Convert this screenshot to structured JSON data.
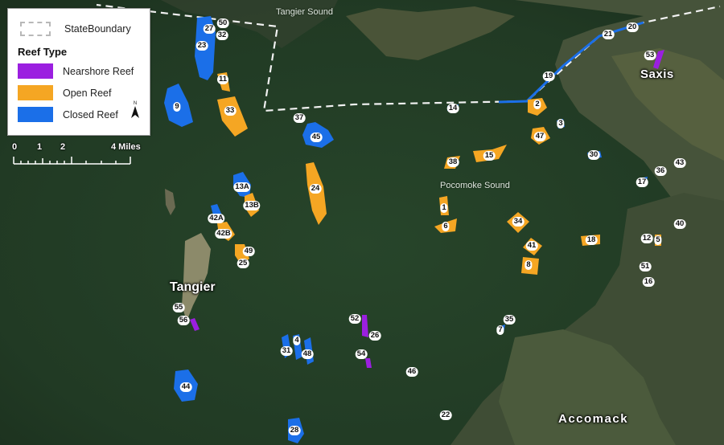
{
  "legend": {
    "boundary_label": "StateBoundary",
    "title": "Reef Type",
    "items": [
      {
        "label": "Nearshore Reef",
        "color": "#9b1fe0"
      },
      {
        "label": "Open Reef",
        "color": "#f5a623"
      },
      {
        "label": "Closed Reef",
        "color": "#1b6fe8"
      }
    ],
    "north_label": "N"
  },
  "scale_bar": {
    "labels": [
      "0",
      "1",
      "2",
      "4 Miles"
    ]
  },
  "places": {
    "tangier": "Tangier",
    "saxis": "Saxis",
    "accomack": "Accomack",
    "tangier_sound": "Tangier Sound",
    "pocomoke_sound": "Pocomoke Sound"
  },
  "reef_labels": [
    "50",
    "27",
    "32",
    "23",
    "11",
    "9",
    "33",
    "37",
    "45",
    "14",
    "2",
    "3",
    "47",
    "19",
    "21",
    "20",
    "53",
    "13A",
    "13B",
    "24",
    "38",
    "15",
    "30",
    "36",
    "43",
    "17",
    "42A",
    "42B",
    "49",
    "25",
    "1",
    "6",
    "34",
    "41",
    "8",
    "18",
    "12",
    "5",
    "40",
    "51",
    "16",
    "55",
    "56",
    "52",
    "26",
    "54",
    "35",
    "7",
    "4",
    "31",
    "48",
    "46",
    "44",
    "22",
    "28"
  ],
  "colors": {
    "nearshore": "#9b1fe0",
    "open": "#f5a623",
    "closed": "#1b6fe8",
    "boundary": "#ffffff"
  }
}
